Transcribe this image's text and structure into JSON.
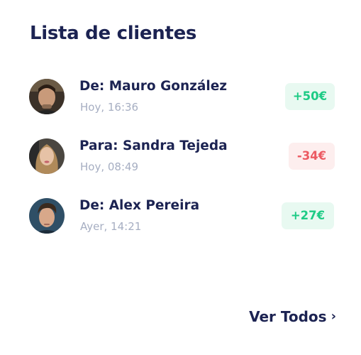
{
  "card": {
    "title": "Lista de clientes",
    "clients": [
      {
        "name": "De: Mauro González",
        "time": "Hoy, 16:36",
        "amount": "+50€",
        "direction": "positive"
      },
      {
        "name": "Para: Sandra Tejeda",
        "time": "Hoy, 08:49",
        "amount": "-34€",
        "direction": "negative"
      },
      {
        "name": "De: Alex Pereira",
        "time": "Ayer, 14:21",
        "amount": "+27€",
        "direction": "positive"
      }
    ],
    "view_all_label": "Ver Todos",
    "view_all_icon": "chevron-right-icon"
  },
  "colors": {
    "title": "#1c2352",
    "secondary_text": "#a6aec2",
    "positive": "#1dcb85",
    "positive_bg": "#e8f9f1",
    "negative": "#ec5a62",
    "negative_bg": "#fdeeee"
  }
}
